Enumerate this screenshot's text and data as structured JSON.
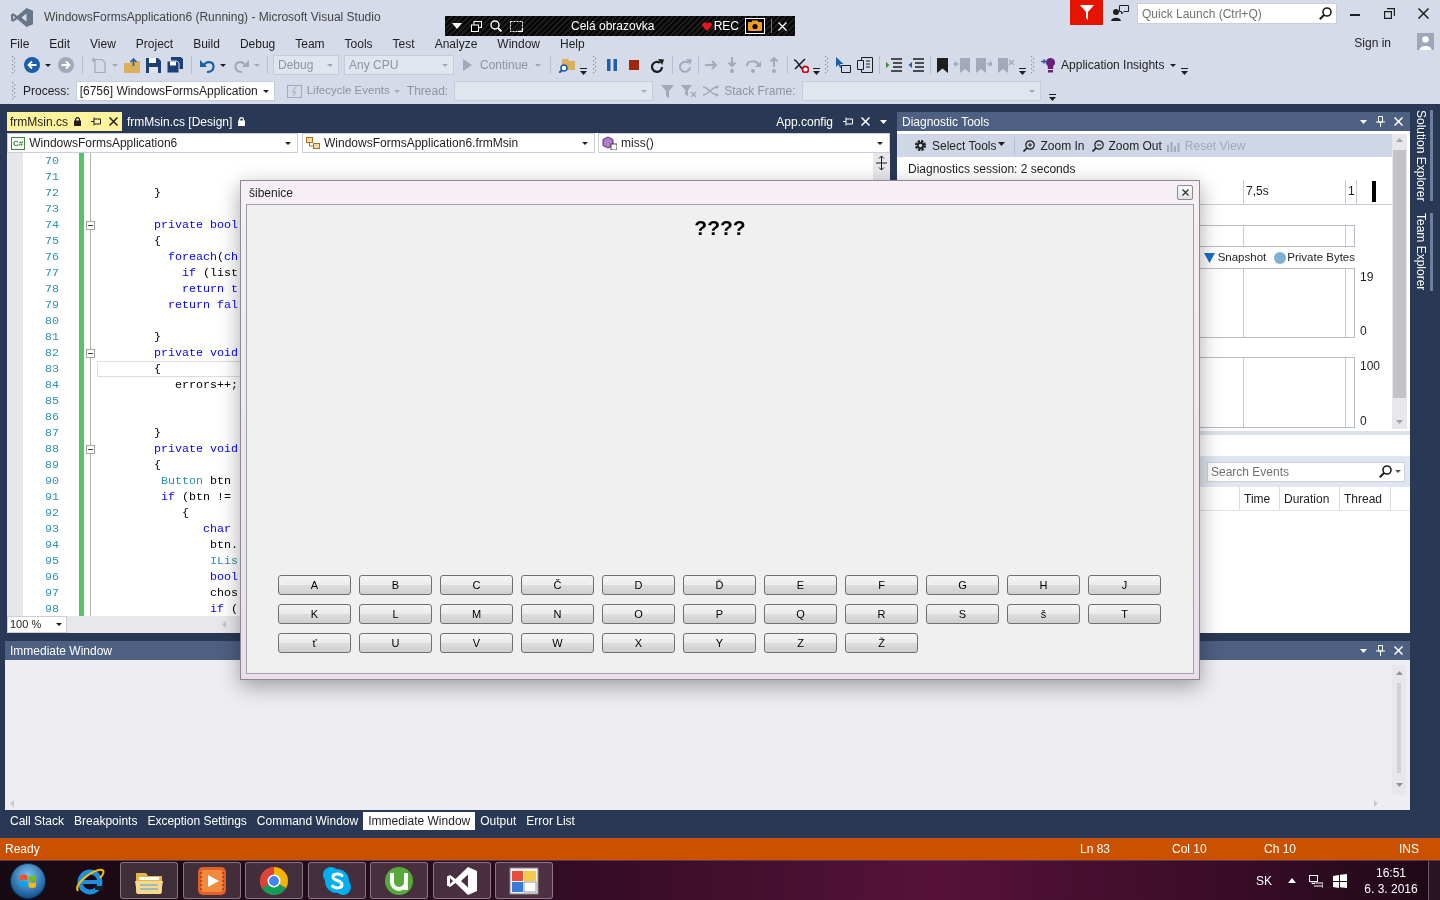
{
  "window": {
    "title": "WindowsFormsApplication6 (Running) - Microsoft Visual Studio"
  },
  "recorder": {
    "mode": "Celá obrazovka",
    "status": "REC"
  },
  "quick_launch": {
    "placeholder": "Quick Launch (Ctrl+Q)"
  },
  "menu": [
    "File",
    "Edit",
    "View",
    "Project",
    "Build",
    "Debug",
    "Team",
    "Tools",
    "Test",
    "Analyze",
    "Window",
    "Help"
  ],
  "account": {
    "sign_in": "Sign in"
  },
  "toolbar": {
    "configuration": {
      "value": "Debug",
      "disabled": true
    },
    "platform": {
      "value": "Any CPU",
      "disabled": true
    },
    "continue": {
      "label": "Continue",
      "disabled": true
    },
    "application_insights": {
      "label": "Application Insights",
      "disabled": false
    }
  },
  "debug_location": {
    "process": {
      "label": "Process:",
      "value": "[6756] WindowsFormsApplication"
    },
    "lifecycle_events": {
      "label": "Lifecycle Events",
      "disabled": true
    },
    "thread": {
      "label": "Thread:",
      "disabled": true
    },
    "stack_frame": {
      "label": "Stack Frame:",
      "disabled": true
    }
  },
  "editor": {
    "tabs": [
      {
        "label": "frmMsin.cs",
        "selected": true,
        "kind": "document"
      },
      {
        "label": "frmMsin.cs [Design]",
        "selected": false,
        "kind": "document"
      },
      {
        "label": "App.config",
        "selected": false,
        "kind": "preview"
      }
    ],
    "navigation": [
      {
        "badge": "C#",
        "label": "WindowsFormsApplication6"
      },
      {
        "label": "WindowsFormsApplication6.frmMsin"
      },
      {
        "label": "miss()"
      }
    ],
    "lines": [
      {
        "number": "70",
        "collapsible": false,
        "current": false
      },
      {
        "number": "71",
        "collapsible": false,
        "current": false
      },
      {
        "number": "72",
        "collapsible": false,
        "current": false,
        "tokens": [
          {
            "text": "        }",
            "kind": "plain"
          }
        ]
      },
      {
        "number": "73",
        "collapsible": false,
        "current": false
      },
      {
        "number": "74",
        "collapsible": true,
        "current": false,
        "tokens": [
          {
            "text": "        private bool",
            "kind": "keyword"
          }
        ]
      },
      {
        "number": "75",
        "collapsible": false,
        "current": false,
        "tokens": [
          {
            "text": "        {",
            "kind": "plain"
          }
        ]
      },
      {
        "number": "76",
        "collapsible": false,
        "current": false,
        "tokens": [
          {
            "text": "          foreach",
            "kind": "keyword"
          },
          {
            "text": "(",
            "kind": "plain"
          },
          {
            "text": "ch",
            "kind": "keyword"
          }
        ]
      },
      {
        "number": "77",
        "collapsible": false,
        "current": false,
        "tokens": [
          {
            "text": "            if",
            "kind": "keyword"
          },
          {
            "text": " (list",
            "kind": "plain"
          }
        ]
      },
      {
        "number": "78",
        "collapsible": false,
        "current": false,
        "tokens": [
          {
            "text": "            return t",
            "kind": "keyword"
          }
        ]
      },
      {
        "number": "79",
        "collapsible": false,
        "current": false,
        "tokens": [
          {
            "text": "          return fal",
            "kind": "keyword"
          }
        ]
      },
      {
        "number": "80",
        "collapsible": false,
        "current": false
      },
      {
        "number": "81",
        "collapsible": false,
        "current": false,
        "tokens": [
          {
            "text": "        }",
            "kind": "plain"
          }
        ]
      },
      {
        "number": "82",
        "collapsible": true,
        "current": false,
        "tokens": [
          {
            "text": "        private void",
            "kind": "keyword"
          }
        ]
      },
      {
        "number": "83",
        "collapsible": false,
        "current": true,
        "tokens": [
          {
            "text": "        {",
            "kind": "plain"
          }
        ]
      },
      {
        "number": "84",
        "collapsible": false,
        "current": false,
        "tokens": [
          {
            "text": "           errors++;",
            "kind": "plain"
          }
        ]
      },
      {
        "number": "85",
        "collapsible": false,
        "current": false
      },
      {
        "number": "86",
        "collapsible": false,
        "current": false
      },
      {
        "number": "87",
        "collapsible": false,
        "current": false,
        "tokens": [
          {
            "text": "        }",
            "kind": "plain"
          }
        ]
      },
      {
        "number": "88",
        "collapsible": true,
        "current": false,
        "tokens": [
          {
            "text": "        private void",
            "kind": "keyword"
          }
        ]
      },
      {
        "number": "89",
        "collapsible": false,
        "current": false,
        "tokens": [
          {
            "text": "        {",
            "kind": "plain"
          }
        ]
      },
      {
        "number": "90",
        "collapsible": false,
        "current": false,
        "tokens": [
          {
            "text": "         Button",
            "kind": "type"
          },
          {
            "text": " btn",
            "kind": "plain"
          }
        ]
      },
      {
        "number": "91",
        "collapsible": false,
        "current": false,
        "tokens": [
          {
            "text": "         if",
            "kind": "keyword"
          },
          {
            "text": " (btn !=",
            "kind": "plain"
          }
        ]
      },
      {
        "number": "92",
        "collapsible": false,
        "current": false,
        "tokens": [
          {
            "text": "            {",
            "kind": "plain"
          }
        ]
      },
      {
        "number": "93",
        "collapsible": false,
        "current": false,
        "tokens": [
          {
            "text": "               char",
            "kind": "keyword"
          }
        ]
      },
      {
        "number": "94",
        "collapsible": false,
        "current": false,
        "tokens": [
          {
            "text": "                btn.",
            "kind": "plain"
          }
        ]
      },
      {
        "number": "95",
        "collapsible": false,
        "current": false,
        "tokens": [
          {
            "text": "                ILis",
            "kind": "type"
          }
        ]
      },
      {
        "number": "96",
        "collapsible": false,
        "current": false,
        "tokens": [
          {
            "text": "                bool",
            "kind": "keyword"
          }
        ]
      },
      {
        "number": "97",
        "collapsible": false,
        "current": false,
        "tokens": [
          {
            "text": "                chos",
            "kind": "plain"
          }
        ]
      },
      {
        "number": "98",
        "collapsible": false,
        "current": false,
        "tokens": [
          {
            "text": "                if",
            "kind": "keyword"
          },
          {
            "text": " (",
            "kind": "plain"
          }
        ]
      }
    ],
    "zoom": "100 %"
  },
  "diagnostic_tools": {
    "title": "Diagnostic Tools",
    "toolbar": [
      {
        "label": "Select Tools",
        "disabled": false
      },
      {
        "label": "Zoom In",
        "disabled": false
      },
      {
        "label": "Zoom Out",
        "disabled": false
      },
      {
        "label": "Reset View",
        "disabled": true
      }
    ],
    "session": "Diagnostics session: 2 seconds",
    "timeline_labels": [
      "7,5s",
      "1"
    ],
    "legend": [
      {
        "label": "Snapshot",
        "kind": "event",
        "color": "#1a70c8"
      },
      {
        "label": "Private Bytes",
        "kind": "series",
        "color": "#7fb2d0"
      }
    ],
    "upper_chart": {
      "axis_labels": [
        "19",
        "0"
      ]
    },
    "lower_chart": {
      "axis_labels": [
        "100",
        "0"
      ]
    },
    "search": {
      "placeholder": "Search Events"
    },
    "event_columns": [
      "Time",
      "Duration",
      "Thread"
    ]
  },
  "side_tabs": [
    "Solution Explorer",
    "Team Explorer"
  ],
  "immediate_window": {
    "title": "Immediate Window"
  },
  "bottom_tabs": [
    {
      "label": "Call Stack",
      "selected": false
    },
    {
      "label": "Breakpoints",
      "selected": false
    },
    {
      "label": "Exception Settings",
      "selected": false
    },
    {
      "label": "Command Window",
      "selected": false
    },
    {
      "label": "Immediate Window",
      "selected": true
    },
    {
      "label": "Output",
      "selected": false
    },
    {
      "label": "Error List",
      "selected": false
    }
  ],
  "status_bar": {
    "message": "Ready",
    "line": "Ln 83",
    "column": "Col 10",
    "character": "Ch 10",
    "mode": "INS"
  },
  "taskbar": {
    "apps": [
      {
        "running": false
      },
      {
        "running": true
      },
      {
        "running": true
      },
      {
        "running": true
      },
      {
        "running": true
      },
      {
        "running": true
      },
      {
        "running": true
      },
      {
        "running": true
      }
    ],
    "language": "SK",
    "time": "16:51",
    "date": "6. 3. 2016"
  },
  "dialog": {
    "title": "šibenice",
    "word": "????",
    "letters": [
      "A",
      "B",
      "C",
      "Č",
      "D",
      "Ď",
      "E",
      "F",
      "G",
      "H",
      "J",
      "K",
      "L",
      "M",
      "N",
      "O",
      "P",
      "Q",
      "R",
      "S",
      "š",
      "T",
      "ť",
      "U",
      "V",
      "W",
      "X",
      "Y",
      "Z",
      "Ž"
    ]
  }
}
